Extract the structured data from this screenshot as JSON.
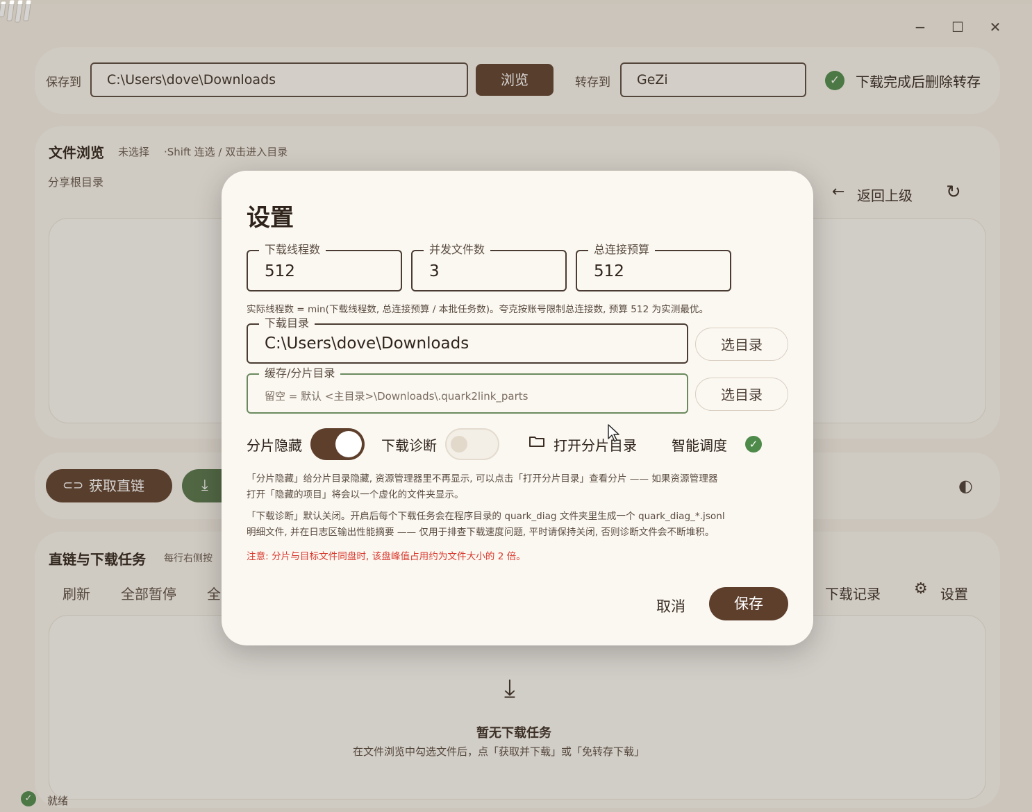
{
  "window": {
    "controls": {
      "minimize": "−",
      "maximize": "☐",
      "close": "✕"
    }
  },
  "top_bar": {
    "save_to_label": "保存到",
    "save_path": "C:\\Users\\dove\\Downloads",
    "browse_label": "浏览",
    "transfer_to_label": "转存到",
    "transfer_value": "GeZi",
    "delete_after_label": "下载完成后删除转存",
    "delete_after_checked": true
  },
  "file_browser": {
    "title": "文件浏览",
    "selection_status": "未选择",
    "hint": "·Shift 连选 / 双击进入目录",
    "breadcrumb": "分享根目录",
    "back_label": "返回上级"
  },
  "actions": {
    "get_link_label": "获取直链"
  },
  "tasks": {
    "title": "直链与下载任务",
    "subtitle": "每行右侧按",
    "refresh_label": "刷新",
    "pause_all_label": "全部暂停",
    "partial_label": "全",
    "history_label": "下载记录",
    "settings_label": "设置",
    "empty_title": "暂无下载任务",
    "empty_hint": "在文件浏览中勾选文件后，点「获取并下载」或「免转存下载」"
  },
  "status_bar": {
    "status": "就绪"
  },
  "dialog": {
    "title": "设置",
    "threads": {
      "label": "下载线程数",
      "value": "512"
    },
    "concurrent_files": {
      "label": "并发文件数",
      "value": "3"
    },
    "total_connections": {
      "label": "总连接预算",
      "value": "512"
    },
    "formula_hint": "实际线程数 = min(下载线程数, 总连接预算 / 本批任务数)。夸克按账号限制总连接数, 预算 512 为实测最优。",
    "download_dir": {
      "label": "下载目录",
      "value": "C:\\Users\\dove\\Downloads",
      "button": "选目录"
    },
    "cache_dir": {
      "label": "缓存/分片目录",
      "placeholder": "留空 = 默认 <主目录>\\Downloads\\.quark2link_parts",
      "button": "选目录"
    },
    "hide_parts": {
      "label": "分片隐藏",
      "on": true
    },
    "diagnostics": {
      "label": "下载诊断",
      "on": false
    },
    "open_parts_label": "打开分片目录",
    "smart_schedule": {
      "label": "智能调度",
      "checked": true
    },
    "note_hide_1": "「分片隐藏」给分片目录隐藏, 资源管理器里不再显示, 可以点击「打开分片目录」查看分片 —— 如果资源管理器",
    "note_hide_2": "打开「隐藏的项目」将会以一个虚化的文件夹显示。",
    "note_diag_1": "「下载诊断」默认关闭。开启后每个下载任务会在程序目录的 quark_diag 文件夹里生成一个 quark_diag_*.jsonl",
    "note_diag_2": "明细文件, 并在日志区输出性能摘要 —— 仅用于排查下载速度问题, 平时请保持关闭, 否则诊断文件会不断堆积。",
    "warning": "注意: 分片与目标文件同盘时, 该盘峰值占用约为文件大小的 2 倍。",
    "cancel_label": "取消",
    "save_label": "保存"
  },
  "colors": {
    "accent_brown": "#5e3f2c",
    "accent_green": "#4e8a4a",
    "warning_red": "#d93a2e",
    "background": "#f1ece3"
  }
}
